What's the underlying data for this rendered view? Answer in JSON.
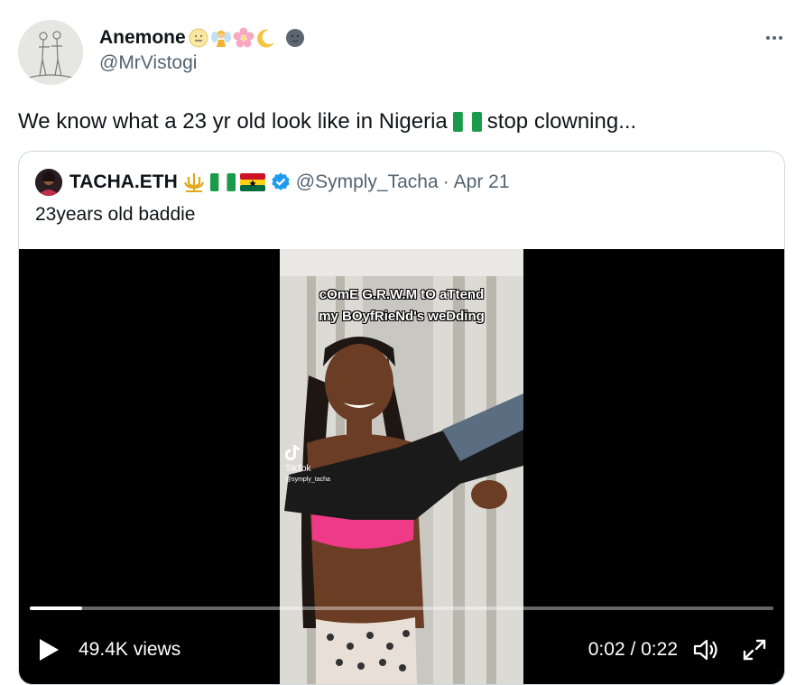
{
  "post": {
    "author_name": "Anemone",
    "author_emojis": [
      "moon-face-emoji",
      "fairy-emoji",
      "cherry-blossom-emoji",
      "crescent-moon-emoji",
      "new-moon-face-emoji"
    ],
    "author_handle": "@MrVistogi",
    "more_icon": "more-horizontal-icon",
    "text_before": "We know what a 23 yr old look like in Nigeria",
    "text_flag": "nigeria-flag-emoji",
    "text_after": "stop clowning..."
  },
  "quote": {
    "author_name": "TACHA.ETH",
    "author_emojis": [
      "trident-emblem-emoji",
      "nigeria-flag-emoji",
      "ghana-flag-emoji"
    ],
    "verified_icon": "verified-badge-icon",
    "author_handle": "@Symply_Tacha",
    "separator": "·",
    "date": "Apr 21",
    "text": "23years old baddie"
  },
  "video": {
    "caption_line1": "cOmE G.R.W.M tO aTtend",
    "caption_line2": "my BOyfRieNd's weDding",
    "watermark_brand": "TikTok",
    "watermark_user": "@symply_tacha",
    "progress": 0.07,
    "views": "49.4K views",
    "time": "0:02 / 0:22",
    "play_icon": "play-icon",
    "volume_icon": "volume-icon",
    "fullscreen_icon": "fullscreen-icon"
  },
  "colors": {
    "text_primary": "#0f1419",
    "text_secondary": "#536471",
    "border": "#cfd9de",
    "verified_blue": "#1d9bf0",
    "video_bg": "#000000"
  }
}
